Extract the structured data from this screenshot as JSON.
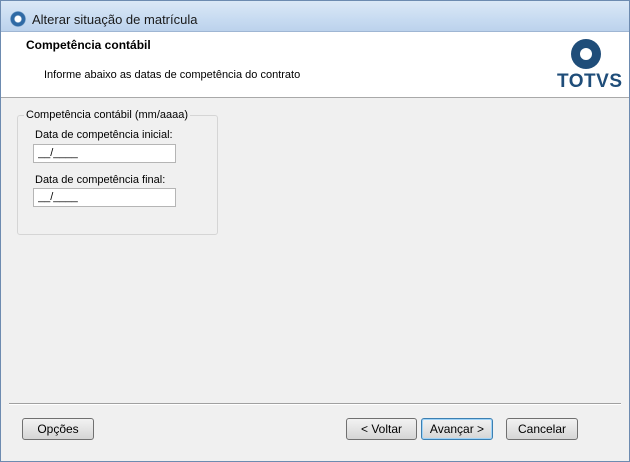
{
  "window": {
    "title": "Alterar situação de matrícula"
  },
  "header": {
    "title": "Competência contábil",
    "description": "Informe abaixo as datas de competência do contrato",
    "logo_text": "TOTVS"
  },
  "form": {
    "group_label": "Competência contábil (mm/aaaa)",
    "initial_label": "Data de competência inicial:",
    "initial_value": "__/____",
    "final_label": "Data de competência final:",
    "final_value": "__/____"
  },
  "footer": {
    "options_label": "Opções",
    "back_label": "< Voltar",
    "next_label": "Avançar >",
    "cancel_label": "Cancelar"
  },
  "colors": {
    "accent": "#1f4d79",
    "titlebar": "#c7dbf1"
  }
}
